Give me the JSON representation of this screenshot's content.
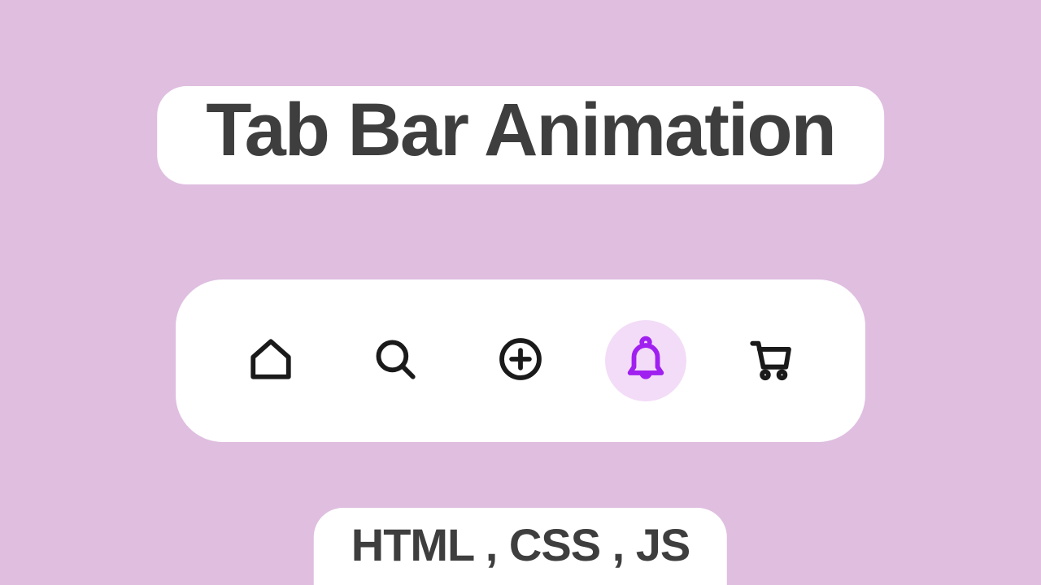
{
  "title": "Tab Bar Animation",
  "tech_label": "HTML , CSS , JS",
  "colors": {
    "background": "#dfbee0",
    "pill": "#ffffff",
    "text": "#3e3e3e",
    "icon": "#1a1a1a",
    "active_bg": "#f3dcf7",
    "active_icon": "#a020f0"
  },
  "tabs": [
    {
      "name": "home",
      "icon": "home-icon",
      "active": false
    },
    {
      "name": "search",
      "icon": "search-icon",
      "active": false
    },
    {
      "name": "add",
      "icon": "plus-circle-icon",
      "active": false
    },
    {
      "name": "notifications",
      "icon": "bell-icon",
      "active": true
    },
    {
      "name": "cart",
      "icon": "cart-icon",
      "active": false
    }
  ]
}
